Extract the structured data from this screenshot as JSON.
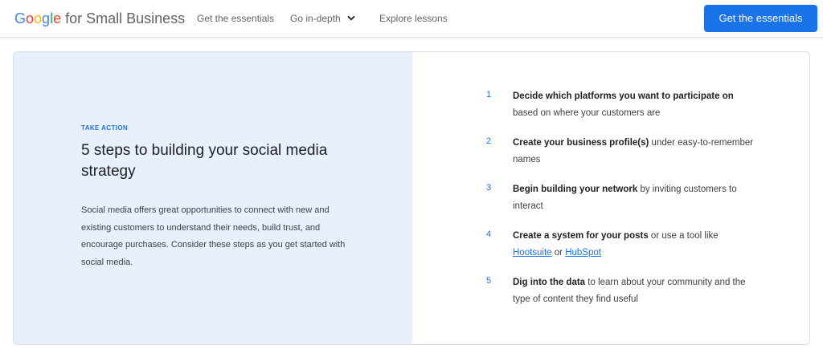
{
  "header": {
    "logo_letters": [
      {
        "char": "G",
        "color": "#4285F4"
      },
      {
        "char": "o",
        "color": "#EA4335"
      },
      {
        "char": "o",
        "color": "#FBBC05"
      },
      {
        "char": "g",
        "color": "#4285F4"
      },
      {
        "char": "l",
        "color": "#34A853"
      },
      {
        "char": "e",
        "color": "#EA4335"
      }
    ],
    "brand_suffix": "for Small Business",
    "nav": {
      "essentials": "Get the essentials",
      "in_depth": "Go in-depth",
      "lessons": "Explore lessons"
    },
    "nav_dropdown_icon": "chevron-down-icon",
    "cta_label": "Get the essentials"
  },
  "content": {
    "eyebrow": "TAKE ACTION",
    "title": "5 steps to building your social media strategy",
    "body": "Social media offers great opportunities to connect with new and existing customers to understand their needs, build trust, and encourage purchases. Consider these steps as you get started with social media.",
    "steps": [
      {
        "number": "1",
        "bold": "Decide which platforms you want to participate on",
        "rest": " based on where your customers are"
      },
      {
        "number": "2",
        "bold": "Create your business profile(s)",
        "rest": " under easy-to-remember names"
      },
      {
        "number": "3",
        "bold": "Begin building your network",
        "rest": " by inviting customers to interact"
      },
      {
        "number": "4",
        "bold": "Create a system for your posts",
        "rest": " or use a tool like ",
        "link1": "Hootsuite",
        "mid": " or ",
        "link2": "HubSpot"
      },
      {
        "number": "5",
        "bold": "Dig into the data",
        "rest": " to learn about your community and the type of content they find useful"
      }
    ]
  },
  "colors": {
    "accent": "#1a73e8",
    "panel_bg": "#e8f0fe"
  }
}
